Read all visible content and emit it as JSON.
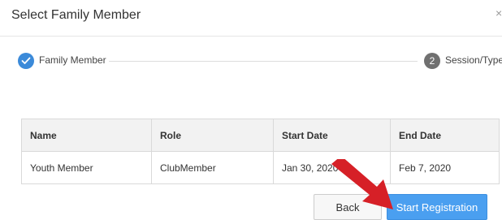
{
  "dialog": {
    "title": "Select Family Member",
    "close_glyph": "×"
  },
  "stepper": {
    "step1": {
      "label": "Family Member",
      "state": "complete",
      "icon": "check-icon"
    },
    "step2": {
      "number": "2",
      "label": "Session/Type",
      "state": "pending"
    }
  },
  "table": {
    "headers": [
      "Name",
      "Role",
      "Start Date",
      "End Date"
    ],
    "rows": [
      [
        "Youth Member",
        "ClubMember",
        "Jan 30, 2020",
        "Feb 7, 2020"
      ]
    ]
  },
  "buttons": {
    "back_label": "Back",
    "start_label": "Start Registration"
  },
  "colors": {
    "accent": "#4a9ff0",
    "step_complete": "#3b8ad9",
    "step_pending": "#707070",
    "annotation_arrow": "#d62027"
  }
}
